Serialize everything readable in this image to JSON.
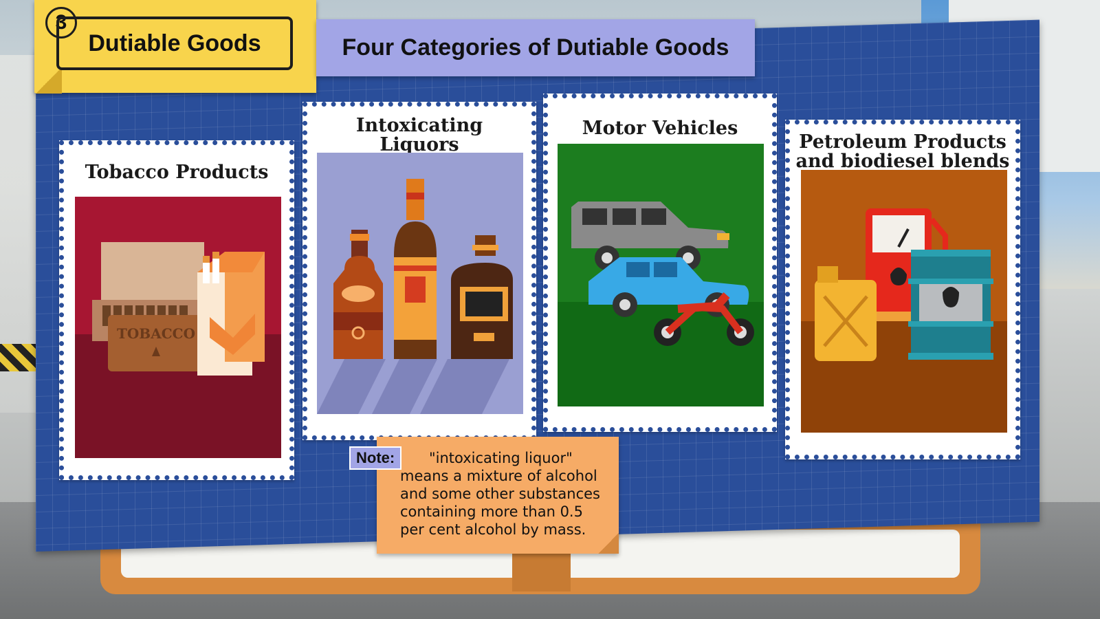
{
  "section": {
    "number": "3",
    "title": "Dutiable Goods",
    "colors": {
      "tag": "#f8d44c"
    }
  },
  "heading": "Four Categories of Dutiable Goods",
  "categories": [
    {
      "title_lines": [
        "Tobacco Products"
      ],
      "art": "tobacco-cigar-box-and-cigarettes",
      "art_color": "#a71632",
      "art_label": "TOBACCO"
    },
    {
      "title_lines": [
        "Intoxicating",
        "Liquors"
      ],
      "art": "liquor-bottles",
      "art_color": "#9a9fd2"
    },
    {
      "title_lines": [
        "Motor Vehicles"
      ],
      "art": "suv-car-motorcycle",
      "art_color": "#1c7d1f"
    },
    {
      "title_lines": [
        "Petroleum Products",
        "and biodiesel blends"
      ],
      "art": "fuel-pump-jerrycan-barrel",
      "art_color": "#b65a10"
    }
  ],
  "note": {
    "label": "Note:",
    "lines": [
      "\"intoxicating liquor\"",
      "means a mixture of alcohol",
      "and some other substances",
      "containing more than 0.5",
      "per cent alcohol by mass."
    ],
    "color": "#f6ab66"
  },
  "colors": {
    "blueprint": "#2a4e9a",
    "heading_bg": "#a2a5e6",
    "board_frame": "#d88a3f"
  }
}
